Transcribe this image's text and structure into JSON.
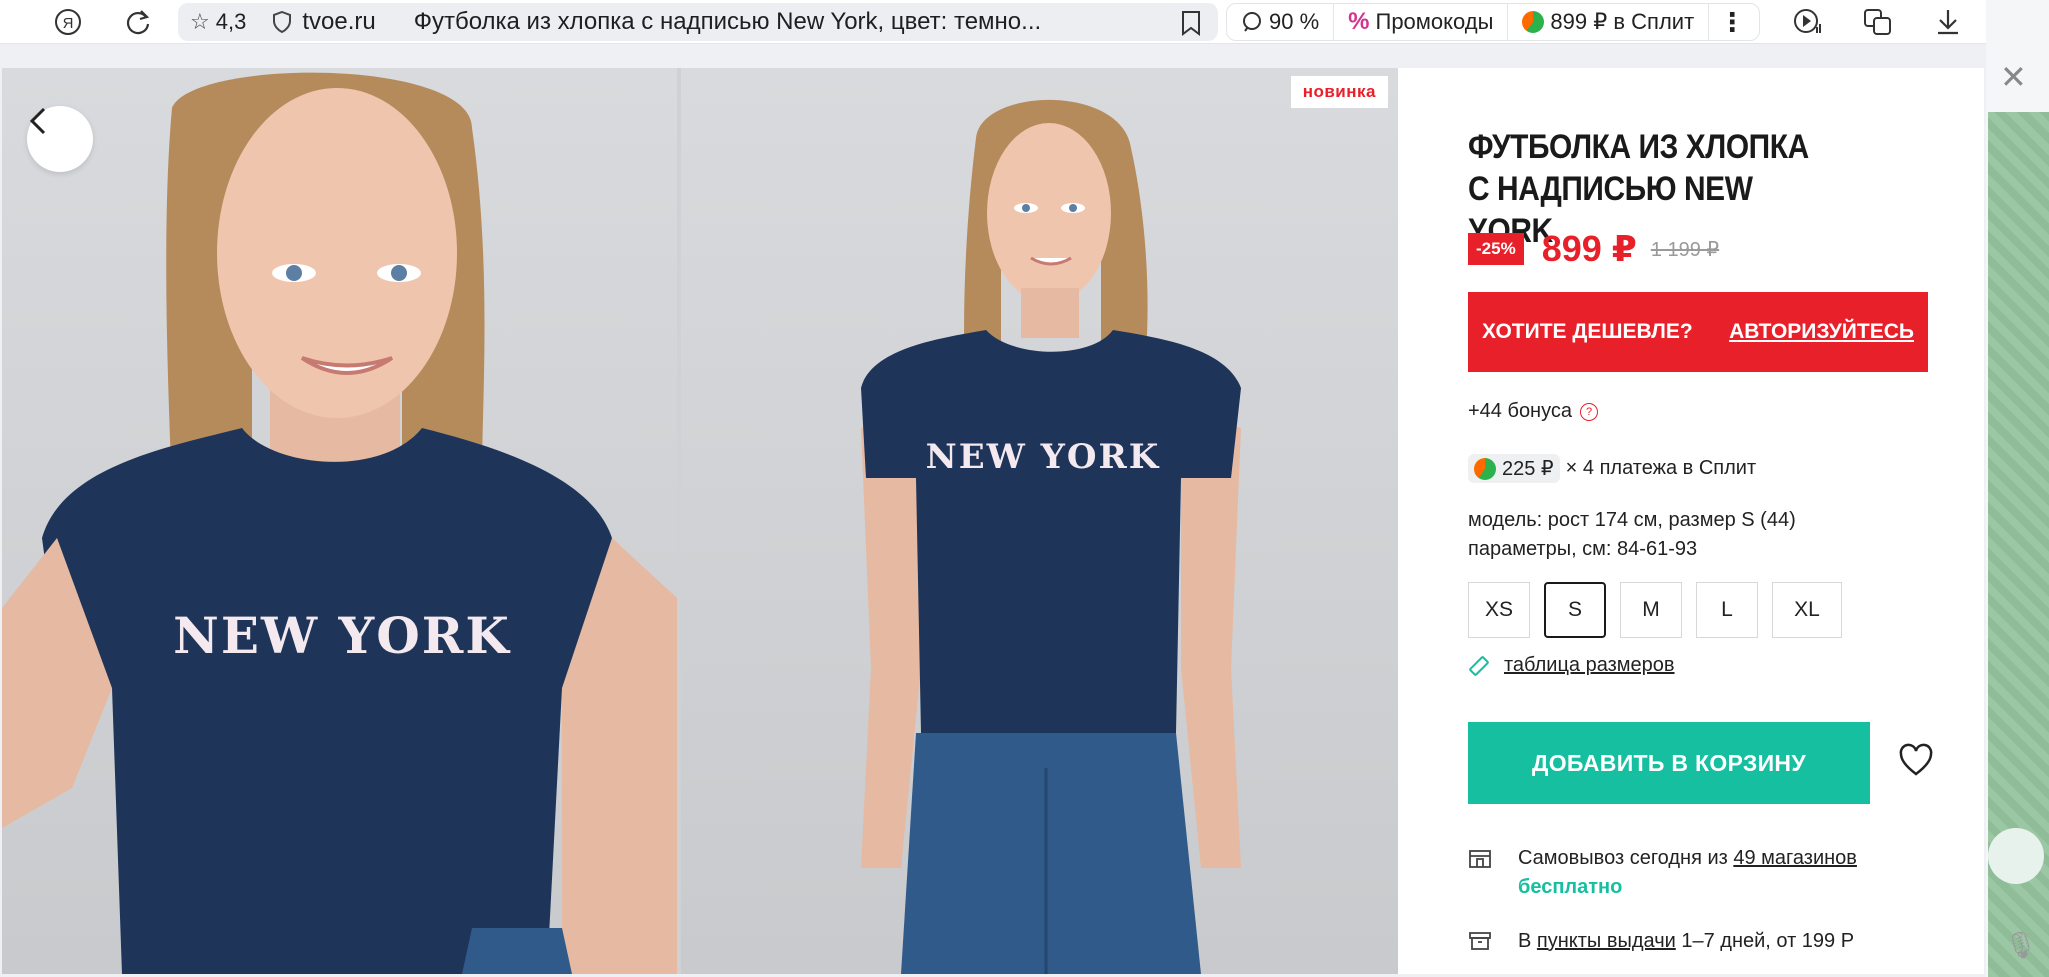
{
  "browser": {
    "rating": "4,3",
    "domain": "tvoe.ru",
    "tab_title": "Футболка из хлопка с надписью New York, цвет: темно...",
    "zoom": "90 %",
    "promo": "Промокоды",
    "split": "899 ₽ в Сплит"
  },
  "gallery": {
    "badge": "новинка",
    "shirt_print": "NEW YORK"
  },
  "product": {
    "title": "Футболка из хлопка с надписью New York",
    "discount": "-25%",
    "price": "899 ₽",
    "old_price": "1 199 ₽",
    "promo_left": "ХОТИТЕ ДЕШЕВЛЕ?",
    "promo_right": "АВТОРИЗУЙТЕСЬ",
    "bonus": "+44 бонуса",
    "split_amount": "225 ₽",
    "split_text": "× 4 платежа в Сплит",
    "model_line1": "модель: рост 174 см, размер S (44)",
    "model_line2": "параметры, см: 84-61-93",
    "sizes": [
      "XS",
      "S",
      "M",
      "L",
      "XL"
    ],
    "selected_size": "S",
    "size_table": "таблица размеров",
    "add_to_cart": "ДОБАВИТЬ В КОРЗИНУ",
    "pickup_prefix": "Самовывоз сегодня из ",
    "pickup_link": "49 магазинов",
    "pickup_free": "бесплатно",
    "points_prefix": "В ",
    "points_link": "пункты выдачи",
    "points_suffix": " 1–7 дней, от 199 Р"
  },
  "colors": {
    "accent_red": "#e8202a",
    "cart_green": "#16bfa0",
    "shirt_navy": "#1f3459"
  }
}
